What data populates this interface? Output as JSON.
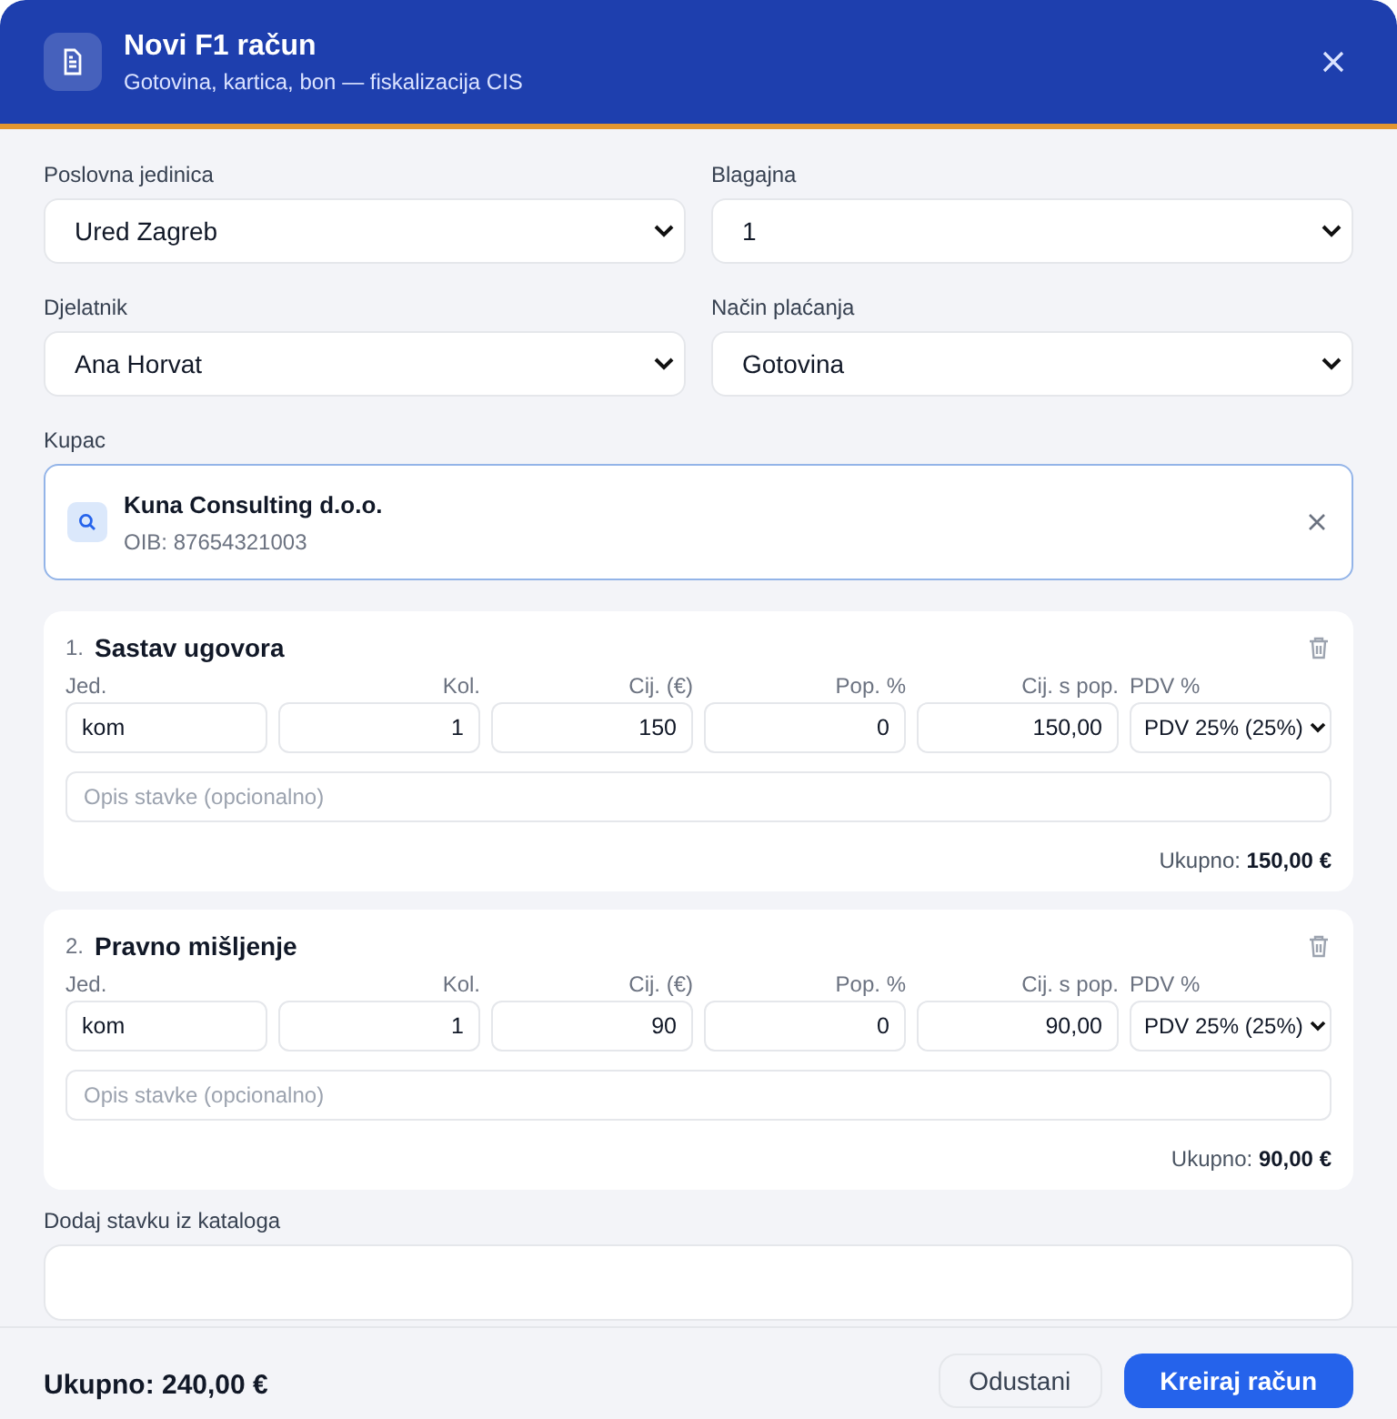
{
  "header": {
    "title": "Novi F1 račun",
    "subtitle": "Gotovina, kartica, bon — fiskalizacija CIS"
  },
  "fields": [
    {
      "label": "Poslovna jedinica",
      "value": "Ured Zagreb"
    },
    {
      "label": "Blagajna",
      "value": "1"
    },
    {
      "label": "Djelatnik",
      "value": "Ana Horvat"
    },
    {
      "label": "Način plaćanja",
      "value": "Gotovina"
    }
  ],
  "customer": {
    "label": "Kupac",
    "name": "Kuna Consulting d.o.o.",
    "oib": "OIB: 87654321003"
  },
  "items": [
    {
      "number": "1.",
      "name": "Sastav ugovora",
      "columns": [
        "Jed.",
        "Kol.",
        "Cij. (€)",
        "Pop. %",
        "Cij. s pop.",
        "PDV %"
      ],
      "unit": "kom",
      "qty": "1",
      "price": "150",
      "discount": "0",
      "price_after": "150,00",
      "vat": "PDV 25% (25%)",
      "description_placeholder": "Opis stavke (opcionalno)",
      "total_label": "Ukupno:",
      "total_value": "150,00 €"
    },
    {
      "number": "2.",
      "name": "Pravno mišljenje",
      "columns": [
        "Jed.",
        "Kol.",
        "Cij. (€)",
        "Pop. %",
        "Cij. s pop.",
        "PDV %"
      ],
      "unit": "kom",
      "qty": "1",
      "price": "90",
      "discount": "0",
      "price_after": "90,00",
      "vat": "PDV 25% (25%)",
      "description_placeholder": "Opis stavke (opcionalno)",
      "total_label": "Ukupno:",
      "total_value": "90,00 €"
    }
  ],
  "catalog": {
    "label": "Dodaj stavku iz kataloga"
  },
  "footer": {
    "total": "Ukupno: 240,00 €",
    "buttons": [
      {
        "label": "Odustani",
        "kind": "secondary"
      },
      {
        "label": "Kreiraj račun",
        "kind": "primary"
      }
    ]
  }
}
